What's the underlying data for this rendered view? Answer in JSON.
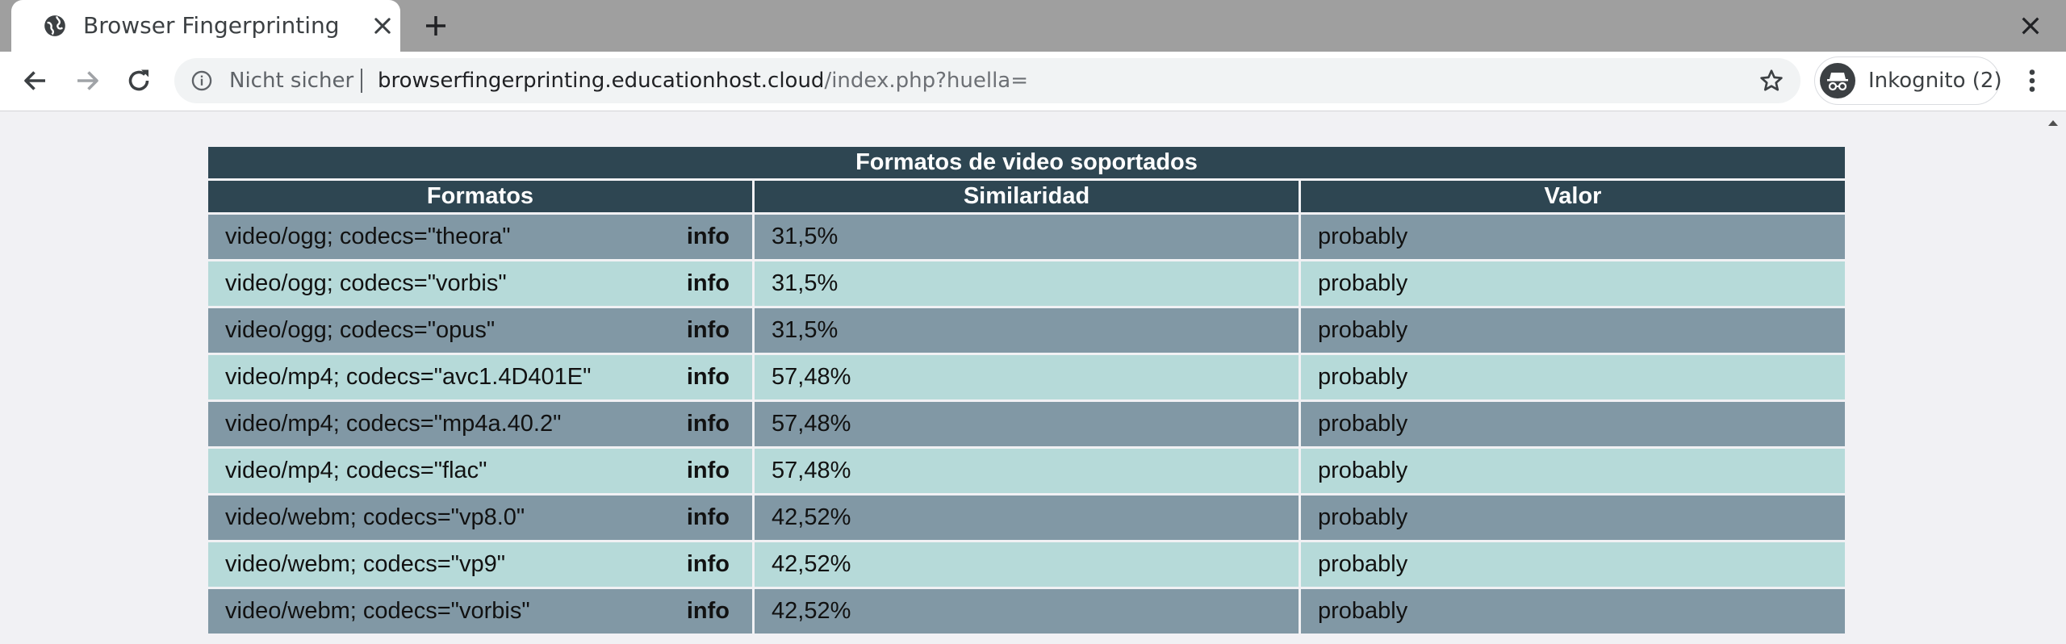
{
  "browser": {
    "tab_title": "Browser Fingerprinting",
    "security_label": "Nicht sicher",
    "url_host": "browserfingerprinting.educationhost.cloud",
    "url_path": "/index.php?huella=",
    "profile_label": "Inkognito (2)",
    "icons": [
      "globe-icon",
      "close-icon",
      "plus-icon",
      "back-arrow-icon",
      "forward-arrow-icon",
      "reload-icon",
      "info-icon",
      "star-icon",
      "incognito-icon",
      "more-vert-icon"
    ]
  },
  "table": {
    "title": "Formatos de video soportados",
    "headers": [
      "Formatos",
      "Similaridad",
      "Valor"
    ],
    "info_label": "info",
    "rows": [
      {
        "format": "video/ogg; codecs=\"theora\"",
        "similarity": "31,5%",
        "value": "probably"
      },
      {
        "format": "video/ogg; codecs=\"vorbis\"",
        "similarity": "31,5%",
        "value": "probably"
      },
      {
        "format": "video/ogg; codecs=\"opus\"",
        "similarity": "31,5%",
        "value": "probably"
      },
      {
        "format": "video/mp4; codecs=\"avc1.4D401E\"",
        "similarity": "57,48%",
        "value": "probably"
      },
      {
        "format": "video/mp4; codecs=\"mp4a.40.2\"",
        "similarity": "57,48%",
        "value": "probably"
      },
      {
        "format": "video/mp4; codecs=\"flac\"",
        "similarity": "57,48%",
        "value": "probably"
      },
      {
        "format": "video/webm; codecs=\"vp8.0\"",
        "similarity": "42,52%",
        "value": "probably"
      },
      {
        "format": "video/webm; codecs=\"vp9\"",
        "similarity": "42,52%",
        "value": "probably"
      },
      {
        "format": "video/webm; codecs=\"vorbis\"",
        "similarity": "42,52%",
        "value": "probably"
      }
    ],
    "colors": {
      "header": "#2e4652",
      "row_dark": "#8198a5",
      "row_light": "#b6dad9"
    }
  }
}
